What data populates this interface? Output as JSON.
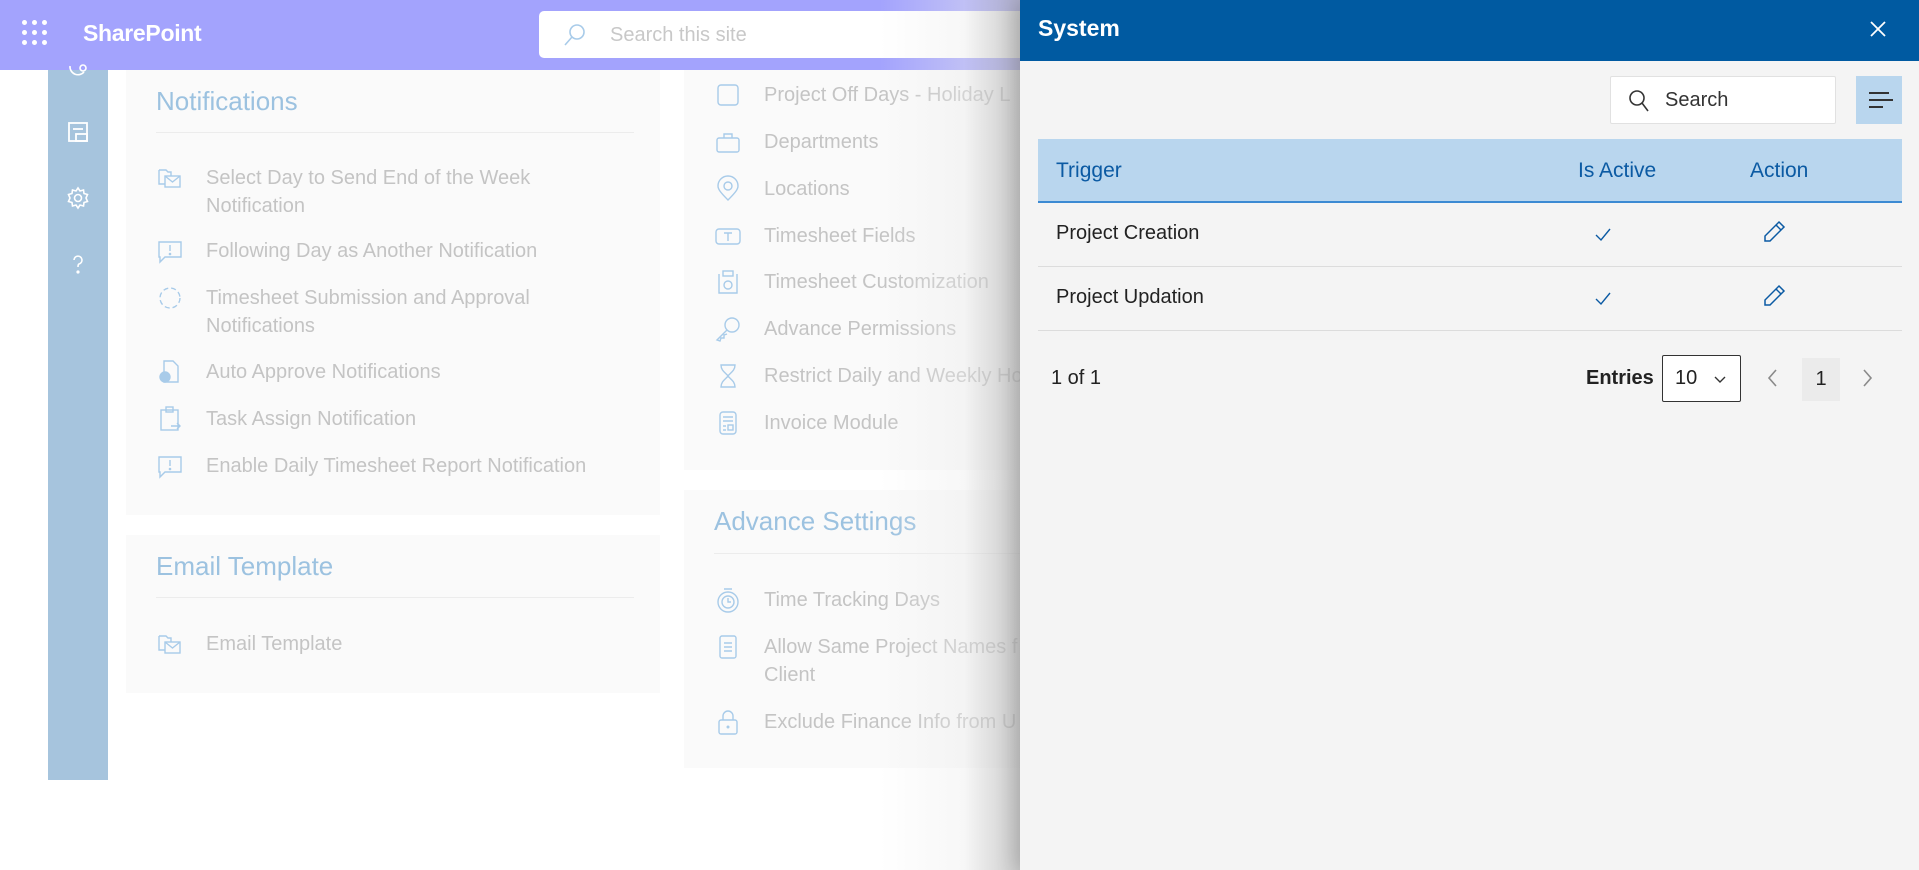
{
  "suitebar": {
    "app_name": "SharePoint",
    "search_placeholder": "Search this site"
  },
  "rail": {
    "icons": [
      "partial-icon",
      "form-icon",
      "settings-icon",
      "help-icon"
    ]
  },
  "notifications": {
    "title": "Notifications",
    "items": [
      {
        "label": "Select Day to Send End of the Week Notification",
        "icon": "mail-folder-icon"
      },
      {
        "label": "Following Day as Another Notification",
        "icon": "alert-comment-icon"
      },
      {
        "label": "Timesheet Submission and Approval Notifications",
        "icon": "sync-circle-icon"
      },
      {
        "label": "Auto Approve Notifications",
        "icon": "document-check-icon"
      },
      {
        "label": "Task Assign Notification",
        "icon": "clipboard-arrow-icon"
      },
      {
        "label": "Enable Daily Timesheet Report Notification",
        "icon": "alert-comment-icon"
      }
    ]
  },
  "email_template": {
    "title": "Email Template",
    "items": [
      {
        "label": "Email Template",
        "icon": "mail-folder-icon"
      }
    ]
  },
  "settings_list": {
    "items": [
      {
        "label": "Project Off Days - Holiday L",
        "icon": "square-icon"
      },
      {
        "label": "Departments",
        "icon": "briefcase-icon"
      },
      {
        "label": "Locations",
        "icon": "location-pin-icon"
      },
      {
        "label": "Timesheet Fields",
        "icon": "text-field-icon"
      },
      {
        "label": "Timesheet Customization",
        "icon": "timesheet-clock-icon"
      },
      {
        "label": "Advance Permissions",
        "icon": "key-icon"
      },
      {
        "label": "Restrict Daily and Weekly Ho",
        "icon": "hourglass-icon"
      },
      {
        "label": "Invoice Module",
        "icon": "calculator-icon"
      }
    ]
  },
  "advance_settings": {
    "title": "Advance Settings",
    "items": [
      {
        "label": "Time Tracking Days",
        "icon": "timer-icon"
      },
      {
        "label": "Allow Same Project Names f Client",
        "icon": "document-lines-icon"
      },
      {
        "label": "Exclude Finance Info from U",
        "icon": "lock-icon"
      }
    ]
  },
  "panel": {
    "title": "System",
    "search_placeholder": "Search",
    "columns": [
      "Trigger",
      "Is Active",
      "Action"
    ],
    "rows": [
      {
        "trigger": "Project Creation",
        "is_active": true
      },
      {
        "trigger": "Project Updation",
        "is_active": true
      }
    ],
    "pager": {
      "count_text": "1 of 1",
      "entries_label": "Entries",
      "entries_value": "10",
      "current_page": "1"
    }
  },
  "colors": {
    "suitebar": "#a3a3fd",
    "panel_header": "#005aa1",
    "table_header": "#b9d6ee",
    "accent_blue": "#0b5aa3"
  }
}
